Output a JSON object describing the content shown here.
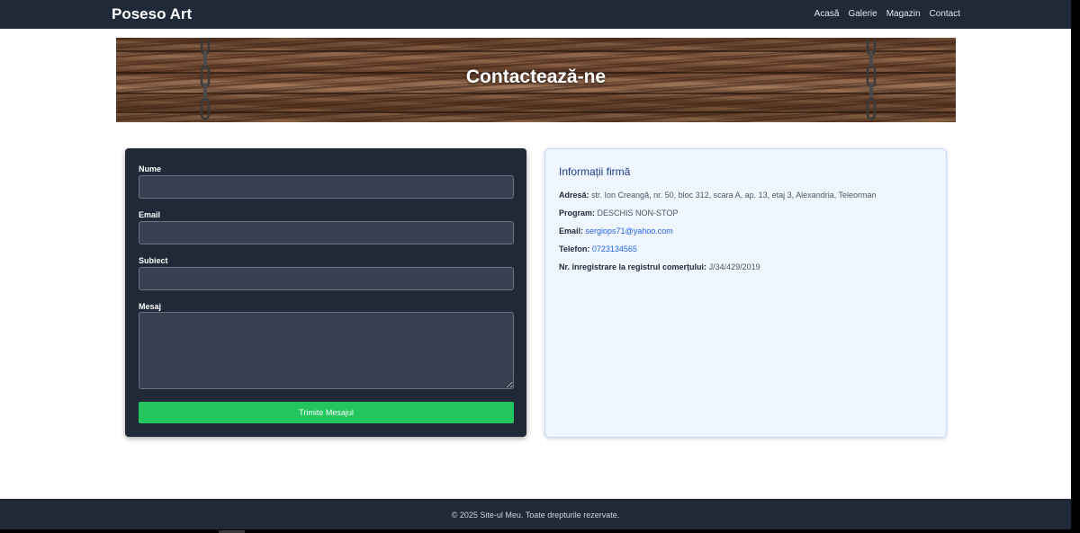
{
  "navbar": {
    "brand": "Poseso Art",
    "links": [
      "Acasă",
      "Galerie",
      "Magazin",
      "Contact"
    ]
  },
  "hero": {
    "title": "Contactează-ne"
  },
  "form": {
    "name_label": "Nume",
    "email_label": "Email",
    "subject_label": "Subiect",
    "message_label": "Mesaj",
    "name_value": "",
    "email_value": "",
    "subject_value": "",
    "message_value": "",
    "submit_label": "Trimite Mesajul"
  },
  "info": {
    "title": "Informații firmă",
    "address_label": "Adresă:",
    "address_value": "str. Ion Creangă, nr. 50, bloc 312, scara A, ap. 13, etaj 3, Alexandria, Teleorman",
    "program_label": "Program:",
    "program_value": "DESCHIS NON-STOP",
    "email_label": "Email:",
    "email_value": "sergiops71@yahoo.com",
    "phone_label": "Telefon:",
    "phone_value": "0723134565",
    "registry_label": "Nr. înregistrare la registrul comerțului:",
    "registry_value": "J/34/429/2019"
  },
  "footer": {
    "text": "© 2025 Site-ul Meu. Toate drepturile rezervate."
  },
  "colors": {
    "navbar_bg": "#1f2937",
    "form_bg": "#1f2937",
    "submit_bg": "#22c55e",
    "info_bg": "#eff6ff",
    "info_title": "#1e3a8a",
    "link": "#2563eb"
  }
}
